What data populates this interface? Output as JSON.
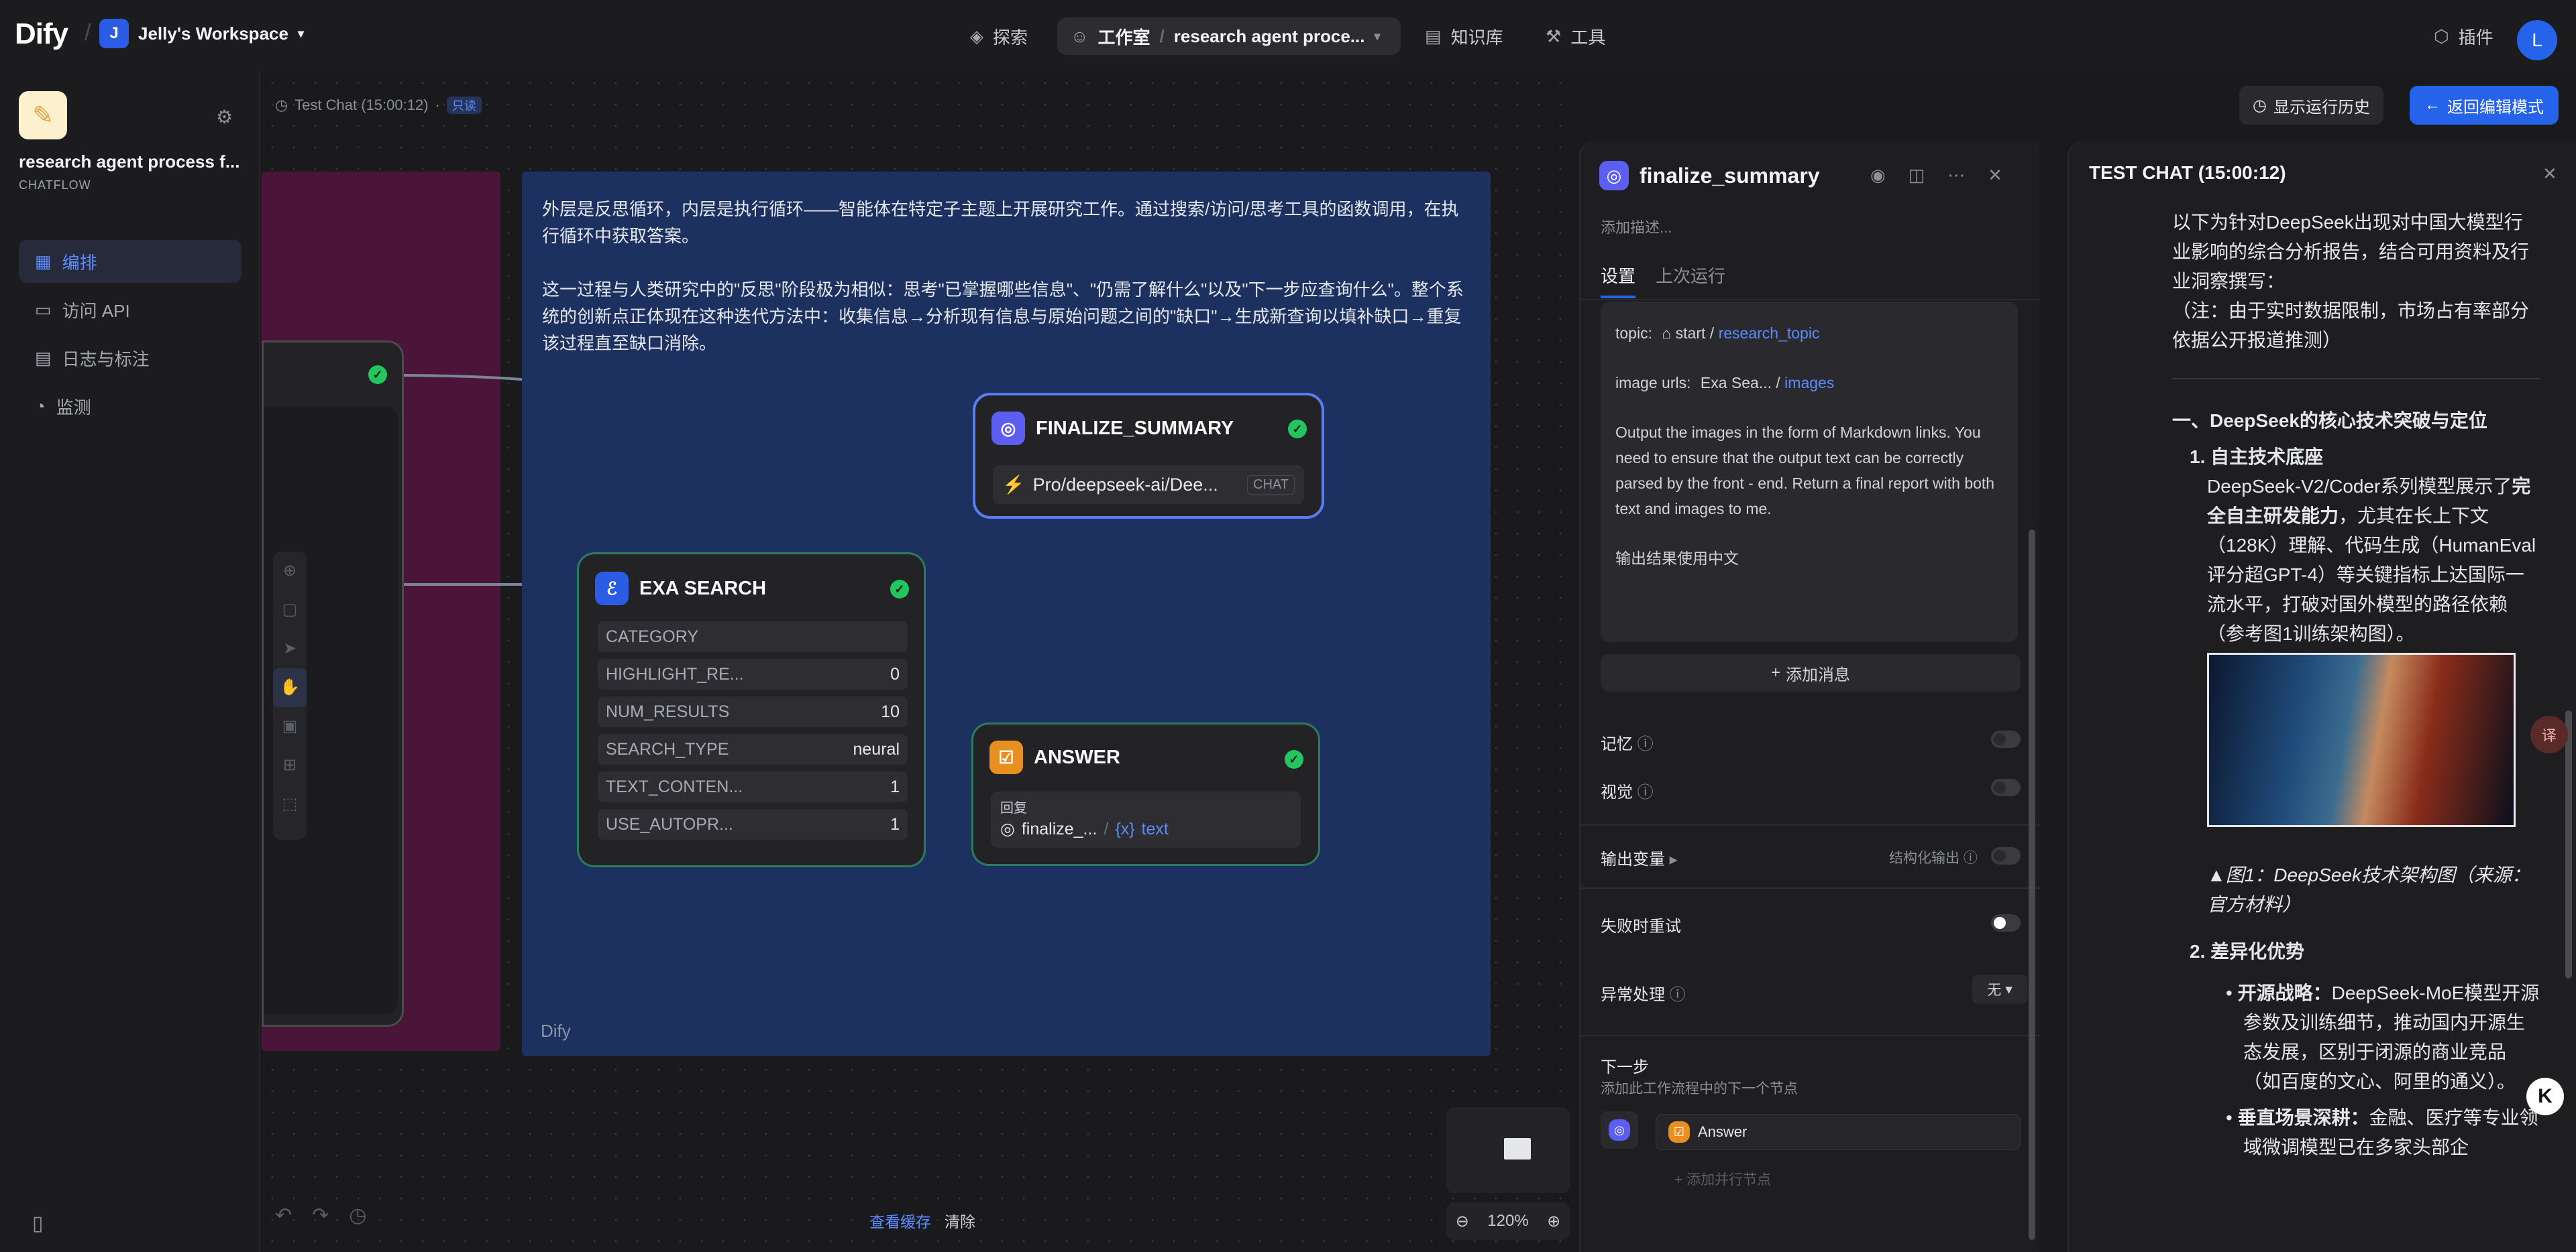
{
  "topbar": {
    "logo": "Dify",
    "workspace_initial": "J",
    "workspace": "Jelly's Workspace",
    "nav": {
      "explore": "探索",
      "studio": "工作室",
      "app_crumb": "research agent proce...",
      "knowledge": "知识库",
      "tools": "工具",
      "plugins": "插件"
    },
    "user_initial": "L"
  },
  "sidebar": {
    "app_name": "research agent process f...",
    "app_type": "CHATFLOW",
    "menu": [
      "编排",
      "访问 API",
      "日志与标注",
      "监测"
    ]
  },
  "canvas": {
    "run_label": "Test Chat (15:00:12)",
    "readonly": "只读",
    "show_history": "显示运行历史",
    "back_edit": "返回编辑模式",
    "view_cache": "查看缓存",
    "clear": "清除",
    "zoom": "120%",
    "note": {
      "p1": "外层是反思循环，内层是执行循环——智能体在特定子主题上开展研究工作。通过搜索/访问/思考工具的函数调用，在执行循环中获取答案。",
      "p2": "这一过程与人类研究中的\"反思\"阶段极为相似：思考\"已掌握哪些信息\"、\"仍需了解什么\"以及\"下一步应查询什么\"。整个系统的创新点正体现在这种迭代方法中：收集信息→分析现有信息与原始问题之间的\"缺口\"→生成新查询以填补缺口→重复该过程直至缺口消除。",
      "footer": "Dify"
    },
    "exa": {
      "title": "EXA SEARCH",
      "params": [
        {
          "k": "CATEGORY",
          "v": ""
        },
        {
          "k": "HIGHLIGHT_RE...",
          "v": "0"
        },
        {
          "k": "NUM_RESULTS",
          "v": "10"
        },
        {
          "k": "SEARCH_TYPE",
          "v": "neural"
        },
        {
          "k": "TEXT_CONTEN...",
          "v": "1"
        },
        {
          "k": "USE_AUTOPR...",
          "v": "1"
        }
      ]
    },
    "finalize": {
      "title": "FINALIZE_SUMMARY",
      "model": "Pro/deepseek-ai/Dee...",
      "model_tag": "CHAT"
    },
    "answer": {
      "title": "ANSWER",
      "reply_label": "回复",
      "var_node": "finalize_...",
      "var_name": "text"
    }
  },
  "panel": {
    "title": "finalize_summary",
    "desc_placeholder": "添加描述...",
    "tabs": [
      "设置",
      "上次运行"
    ],
    "prompt": {
      "topic_label": "topic:",
      "topic_node": "start",
      "topic_var": "research_topic",
      "img_label": "image urls:",
      "img_node": "Exa Sea...",
      "img_var": "images",
      "body": "Output the images in the form of Markdown links. You need to ensure that the output text can be correctly parsed by the front - end. Return a final report with both text and images to me.",
      "lang": "输出结果使用中文"
    },
    "add_message": "添加消息",
    "memory": "记忆",
    "vision": "视觉",
    "output_vars": "输出变量",
    "structured_output": "结构化输出",
    "retry": "失败时重试",
    "error_handling": "异常处理",
    "error_value": "无",
    "next_step": "下一步",
    "next_desc": "添加此工作流程中的下一个节点",
    "next_node": "Answer",
    "add_parallel": "添加并行节点"
  },
  "chat": {
    "title": "TEST CHAT (15:00:12)",
    "intro": "以下为针对DeepSeek出现对中国大模型行业影响的综合分析报告，结合可用资料及行业洞察撰写：",
    "note": "（注：由于实时数据限制，市场占有率部分依据公开报道推测）",
    "h1": "一、DeepSeek的核心技术突破与定位",
    "item1_title": "自主技术底座",
    "item1_a": "DeepSeek-V2/Coder系列模型展示了",
    "item1_b": "完全自主研发能力",
    "item1_c": "，尤其在长上下文（128K）理解、代码生成（HumanEval评分超GPT-4）等关键指标上达国际一流水平，打破对国外模型的路径依赖（参考图1训练架构图）。",
    "caption": "▲图1：DeepSeek技术架构图（来源：官方材料）",
    "item2_title": "差异化优势",
    "b1_title": "开源战略：",
    "b1": "DeepSeek-MoE模型开源参数及训练细节，推动国内开源生态发展，区别于闭源的商业竞品（如百度的文心、阿里的通义）。",
    "b2_title": "垂直场景深耕：",
    "b2": "金融、医疗等专业领域微调模型已在多家头部企"
  }
}
